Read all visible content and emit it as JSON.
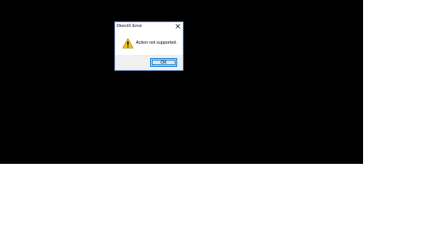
{
  "dialog": {
    "title": "DirectX Error",
    "message": "Action not supported.",
    "ok_label": "OK",
    "icon": "warning-icon",
    "close_icon": "close-icon"
  },
  "colors": {
    "background": "#000000",
    "dialog_border": "#7a9bd1",
    "footer": "#f0f0f0",
    "button_focus": "#0078d7",
    "warning_fill": "#f5c211"
  }
}
